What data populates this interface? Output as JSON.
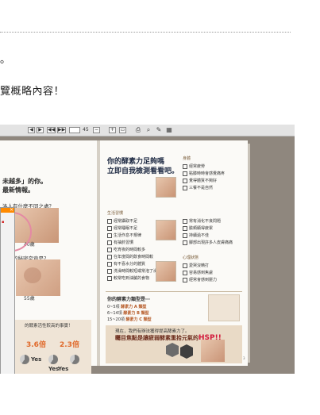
{
  "article": {
    "line1": "。",
    "line2": "覽概略內容！"
  },
  "viewer": {
    "toolbar": {
      "page_current": "",
      "page_total": "45",
      "icons": [
        "prev-page-icon",
        "next-page-icon",
        "first-page-icon",
        "last-page-icon",
        "zoom-out-icon",
        "zoom-in-icon",
        "fit-page-icon",
        "print-icon",
        "search-icon",
        "share-icon",
        "settings-icon"
      ]
    },
    "left_page": {
      "heading1": "未越多」的你。",
      "heading2": "最新情報。",
      "question1": "洛人有什麼不同之處？",
      "age1": "40歲",
      "question2": "印象的秘密究竟是？",
      "age2": "55歲",
      "box_title": "的酵素活性較高的事實！",
      "stat1": "3.6倍",
      "stat2": "2.3倍",
      "yes_labels": [
        "Yes",
        "Yes",
        "Yes"
      ]
    },
    "right_page": {
      "title1": "你的酵素力足夠嗎",
      "title2": "立即自我檢測看看吧。",
      "left_checklist_head": "生活習慣",
      "left_checklist": [
        "經常攝取不足",
        "經常睡眠不足",
        "生活作息不規律",
        "有抽菸習慣",
        "吃宵夜的時間較多",
        "在年度間的飲食時間較",
        "有不喜水分的體質",
        "洗澡時間較短或常泡了澡",
        "較常吃到油膩的食物"
      ],
      "right_checklist_head": "身體",
      "right_checklist": [
        "經常疲勞",
        "點膝時時會感覺痛疼",
        "覺得體質不夠好",
        "三餐不是自然",
        "常有消化不良問題",
        "臉頰顯得疲累",
        "持續過不佳",
        "腳部出現許多人皮膚痛痛",
        "心理狀態",
        "愛哭沒精打",
        "容易感到焦慮",
        "經常會感到壓力"
      ],
      "sub_heading": "你的酵素力類型是⋯",
      "rows": [
        {
          "range": "0~5項",
          "grade": "酵素力 A 類型"
        },
        {
          "range": "6~14項",
          "grade": "酵素力 B 類型"
        },
        {
          "range": "15~20項",
          "grade": "酵素力 C 類型"
        }
      ],
      "bottom_small": "現在，我們有辦法獲得提高酵素力了。",
      "bottom_big": "矚目焦點是讓疲弱酵素重拾元氣的",
      "bottom_hsp": "HSP!!",
      "page_number": "3"
    }
  }
}
